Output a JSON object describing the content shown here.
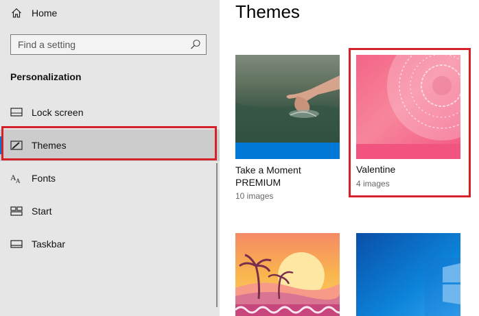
{
  "sidebar": {
    "home_label": "Home",
    "search_placeholder": "Find a setting",
    "section_title": "Personalization",
    "items": [
      {
        "label": "Lock screen",
        "icon": "lock-screen-icon"
      },
      {
        "label": "Themes",
        "icon": "themes-icon",
        "selected": true
      },
      {
        "label": "Fonts",
        "icon": "fonts-icon"
      },
      {
        "label": "Start",
        "icon": "start-icon"
      },
      {
        "label": "Taskbar",
        "icon": "taskbar-icon"
      }
    ]
  },
  "main": {
    "title": "Themes",
    "themes": [
      {
        "name": "Take a Moment PREMIUM",
        "count": "10 images"
      },
      {
        "name": "Valentine",
        "count": "4 images",
        "highlighted": true
      }
    ]
  },
  "colors": {
    "accent": "#0078d7",
    "highlight": "#d62029",
    "sidebar_bg": "#e6e6e6",
    "selected_bg": "#cccccc"
  }
}
